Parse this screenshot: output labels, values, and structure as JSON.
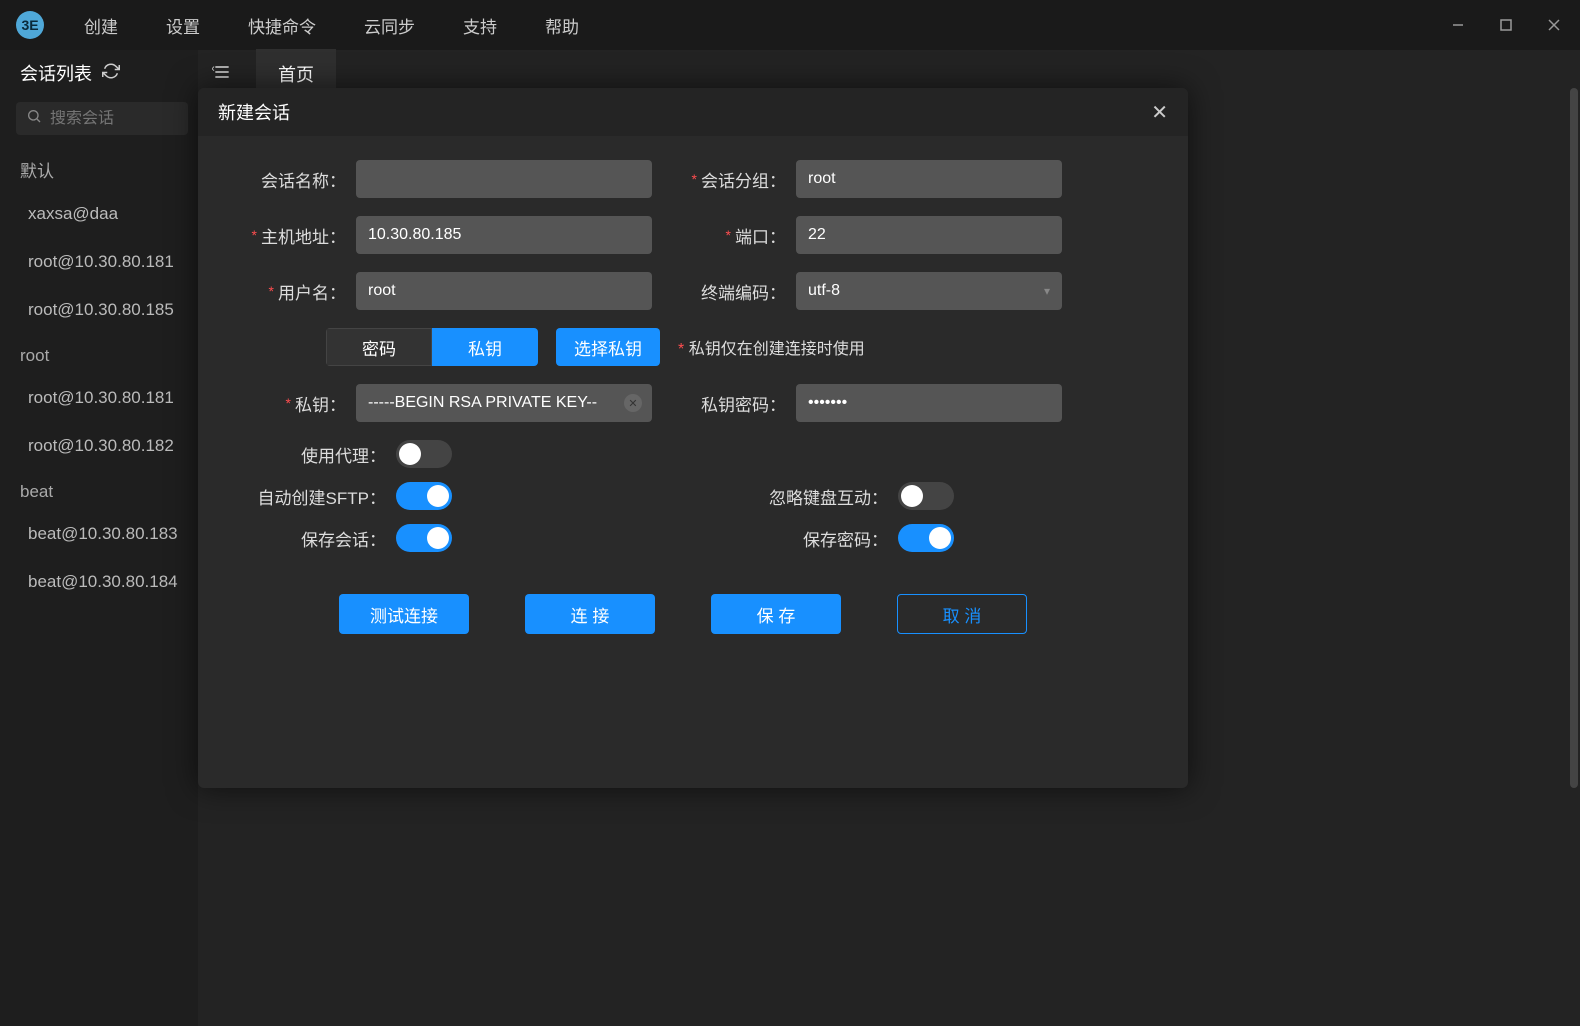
{
  "menubar": [
    "创建",
    "设置",
    "快捷命令",
    "云同步",
    "支持",
    "帮助"
  ],
  "sidebar": {
    "title": "会话列表",
    "search_placeholder": "搜索会话",
    "groups": [
      {
        "name": "默认",
        "items": [
          "xaxsa@daa",
          "root@10.30.80.181",
          "root@10.30.80.185"
        ]
      },
      {
        "name": "root",
        "items": [
          "root@10.30.80.181",
          "root@10.30.80.182"
        ]
      },
      {
        "name": "beat",
        "items": [
          "beat@10.30.80.183",
          "beat@10.30.80.184"
        ]
      }
    ]
  },
  "tab": {
    "home": "首页"
  },
  "dialog": {
    "title": "新建会话",
    "labels": {
      "session_name": "会话名称：",
      "session_group": "会话分组：",
      "host": "主机地址：",
      "port": "端口：",
      "username": "用户名：",
      "encoding": "终端编码：",
      "password_tab": "密码",
      "key_tab": "私钥",
      "select_key": "选择私钥",
      "key_hint_prefix": "*",
      "key_hint": "私钥仅在创建连接时使用",
      "private_key": "私钥：",
      "key_password": "私钥密码：",
      "use_proxy": "使用代理：",
      "auto_sftp": "自动创建SFTP：",
      "ignore_keyboard": "忽略键盘互动：",
      "save_session": "保存会话：",
      "save_password": "保存密码："
    },
    "values": {
      "session_name": "",
      "session_group": "root",
      "host": "10.30.80.185",
      "port": "22",
      "username": "root",
      "encoding": "utf-8",
      "private_key": "-----BEGIN RSA PRIVATE KEY--",
      "key_password": "•••••••"
    },
    "toggles": {
      "use_proxy": false,
      "auto_sftp": true,
      "ignore_keyboard": false,
      "save_session": true,
      "save_password": true
    },
    "buttons": {
      "test": "测试连接",
      "connect": "连 接",
      "save": "保 存",
      "cancel": "取 消"
    }
  }
}
